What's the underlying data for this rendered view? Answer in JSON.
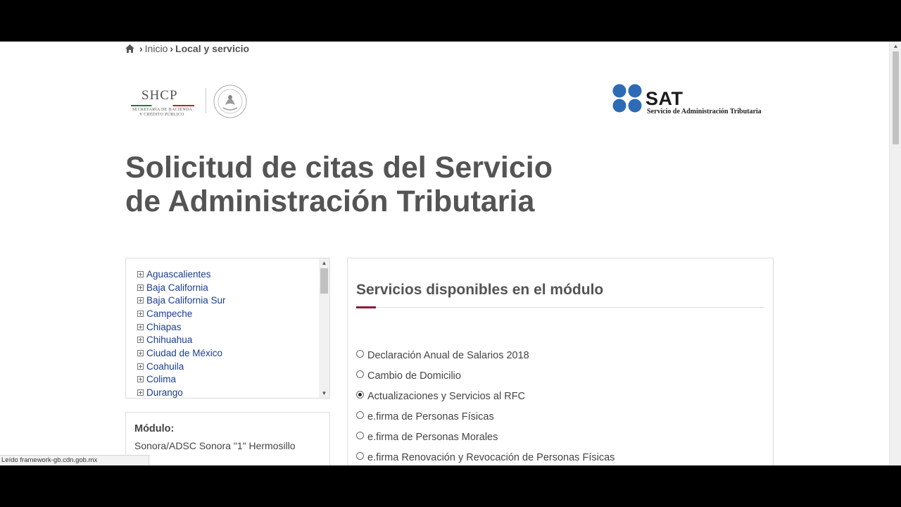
{
  "breadcrumb": {
    "items": [
      "Inicio",
      "Local y servicio"
    ]
  },
  "logos": {
    "shcp_title": "SHCP",
    "shcp_sub1": "SECRETARÍA DE HACIENDA",
    "shcp_sub2": "Y CRÉDITO PÚBLICO",
    "sat_title": "SAT",
    "sat_sub": "Servicio de Administración Tributaria",
    "sat_dot_color": "#2d6bb5"
  },
  "page": {
    "title": "Solicitud de citas del Servicio de Administración Tributaria"
  },
  "states": {
    "items": [
      "Aguascalientes",
      "Baja California",
      "Baja California Sur",
      "Campeche",
      "Chiapas",
      "Chihuahua",
      "Ciudad de México",
      "Coahuila",
      "Colima",
      "Durango"
    ]
  },
  "module": {
    "label": "Módulo:",
    "value": "Sonora/ADSC Sonora \"1\" Hermosillo"
  },
  "services": {
    "title": "Servicios disponibles en el módulo",
    "accent_color": "#8b1d3b",
    "selected_index": 2,
    "options": [
      "Declaración Anual de Salarios 2018",
      "Cambio de Domicilio",
      "Actualizaciones y Servicios al RFC",
      "e.firma de Personas Físicas",
      "e.firma de Personas Morales",
      "e.firma Renovación y Revocación de Personas Físicas"
    ]
  },
  "statusbar": {
    "text": "Leído framework-gb.cdn.gob.mx"
  }
}
